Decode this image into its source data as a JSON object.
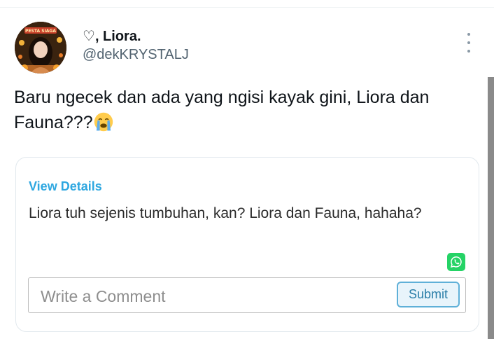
{
  "tweet": {
    "author": {
      "heart": "♡",
      "name": ", Liora.",
      "handle": "@dekKRYSTALJ",
      "avatar_banner_text": "PESTA SIAGA"
    },
    "text": "Baru ngecek dan ada yang ngisi kayak gini, Liora dan Fauna???",
    "text_emoji": "loudly-crying-face-emoji",
    "more_icon": "more-vertical-icon"
  },
  "card": {
    "view_details": "View Details",
    "comment": "Liora tuh sejenis tumbuhan, kan? Liora dan Fauna, hahaha?",
    "share_icon": "whatsapp-icon",
    "input_placeholder": "Write a Comment",
    "submit_label": "Submit"
  },
  "colors": {
    "link": "#2ea7e0",
    "whatsapp": "#25d366",
    "submit_border": "#5fb0d8",
    "handle": "#536471"
  }
}
